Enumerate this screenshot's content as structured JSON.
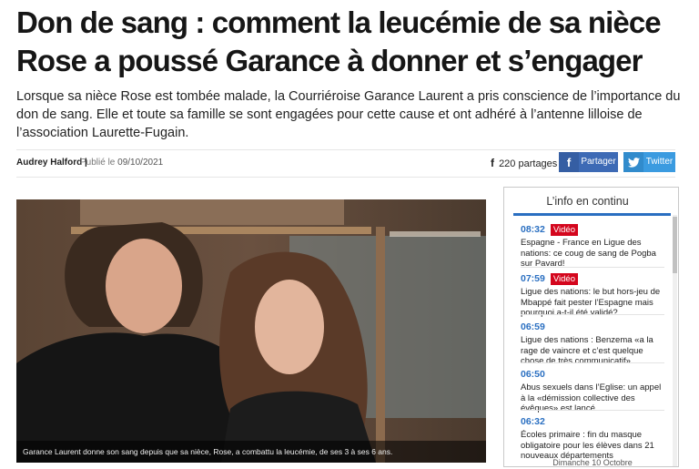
{
  "article": {
    "headline": "Don de sang : comment la leucémie de sa nièce Rose a poussé Garance à donner et s’engager",
    "lead": "Lorsque sa nièce Rose est tombée malade, la Courriéroise Garance Laurent a pris conscience de l’importance du don de sang. Elle et toute sa famille se sont engagées pour cette cause et ont adhéré à l’antenne lilloise de l’association Laurette-Fugain.",
    "author": "Audrey Halford |",
    "published_label": "Publié le",
    "published_date": "09/10/2021",
    "shares_icon": "f",
    "shares_count": "220",
    "shares_label": "partages",
    "share_facebook": "Partager",
    "share_twitter": "Twitter",
    "photo_caption": "Garance Laurent donne son sang depuis que sa nièce, Rose, a combattu la leucémie, de ses 3 à ses 6 ans."
  },
  "sidebar": {
    "title": "L’info en continu",
    "items": [
      {
        "time": "08:32",
        "tag": "Vidéo",
        "text": "Espagne - France en Ligue des nations: ce coug de sang de Pogba sur Pavard!"
      },
      {
        "time": "07:59",
        "tag": "Vidéo",
        "text": "Ligue des nations: le but hors-jeu de Mbappé fait pester l’Espagne mais pourquoi a-t-il été validé?"
      },
      {
        "time": "06:59",
        "tag": "",
        "text": "Ligue des nations : Benzema «a la rage de vaincre et c’est quelque chose de très communicatif»"
      },
      {
        "time": "06:50",
        "tag": "",
        "text": "Abus sexuels dans l’Eglise: un appel à la «démission collective des évêques» est lancé"
      },
      {
        "time": "06:32",
        "tag": "",
        "text": "Écoles primaire : fin du masque obligatoire pour les élèves dans 21 nouveaux départements"
      }
    ],
    "day_label": "Dimanche 10 Octobre"
  },
  "colors": {
    "accent_blue": "#2a6fc1",
    "video_tag_red": "#d4061d",
    "facebook": "#3d6ab5",
    "twitter": "#3b9be0"
  },
  "icons": {
    "facebook": "facebook-icon",
    "twitter": "twitter-icon"
  }
}
